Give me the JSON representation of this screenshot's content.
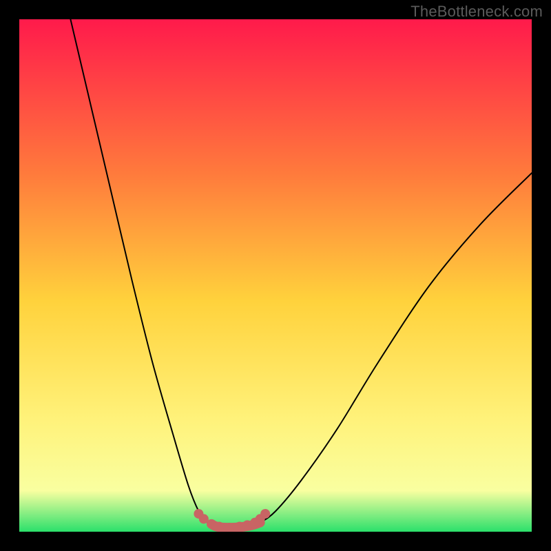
{
  "watermark": "TheBottleneck.com",
  "colors": {
    "frame": "#000000",
    "gradient_top": "#ff1a4b",
    "gradient_mid1": "#ff7a3c",
    "gradient_mid2": "#ffd23c",
    "gradient_mid3": "#fff27a",
    "gradient_low": "#f9ffa0",
    "gradient_bottom": "#2be06b",
    "curve": "#000000",
    "marker": "#c86464"
  },
  "chart_data": {
    "type": "line",
    "title": "",
    "xlabel": "",
    "ylabel": "",
    "xlim": [
      0,
      100
    ],
    "ylim": [
      0,
      100
    ],
    "series": [
      {
        "name": "curve-left",
        "x": [
          10,
          14,
          18,
          22,
          26,
          30,
          33,
          35,
          36.5,
          37.5
        ],
        "y": [
          100,
          83,
          66,
          49,
          33,
          19,
          9,
          4,
          2,
          1.5
        ]
      },
      {
        "name": "floor",
        "x": [
          37.5,
          38.5,
          40,
          42,
          44,
          45.5,
          47
        ],
        "y": [
          1.5,
          1,
          0.8,
          0.8,
          1,
          1.3,
          1.8
        ]
      },
      {
        "name": "curve-right",
        "x": [
          47,
          50,
          55,
          62,
          70,
          80,
          90,
          100
        ],
        "y": [
          1.8,
          4,
          10,
          20,
          33,
          48,
          60,
          70
        ]
      }
    ],
    "markers": {
      "name": "floor-dots",
      "x": [
        35,
        36,
        37.5,
        39,
        41,
        43,
        44.5,
        46,
        47,
        48
      ],
      "y": [
        3.5,
        2.5,
        1.5,
        1,
        0.8,
        1,
        1.3,
        1.8,
        2.5,
        3.5
      ]
    }
  }
}
